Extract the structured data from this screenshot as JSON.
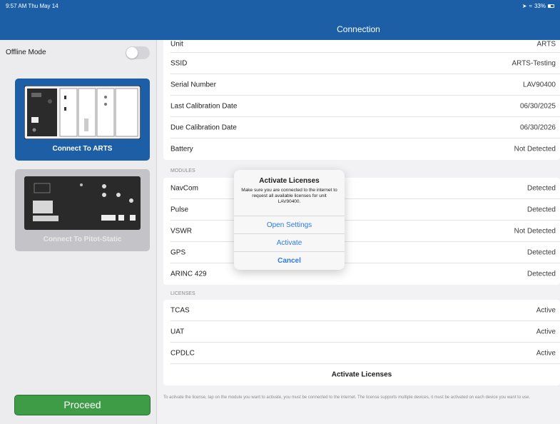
{
  "status": {
    "time": "9:57 AM  Thu May 14",
    "battery": "33%"
  },
  "nav": {
    "title": "Connection"
  },
  "sidebar": {
    "offline_label": "Offline Mode",
    "offline_on": false,
    "arts_label": "Connect To ARTS",
    "pitot_label": "Connect To Pitot-Static",
    "proceed_label": "Proceed"
  },
  "info_rows": [
    {
      "label": "Unit",
      "value": "ARTS"
    },
    {
      "label": "SSID",
      "value": "ARTS-Testing"
    },
    {
      "label": "Serial Number",
      "value": "LAV90400"
    },
    {
      "label": "Last Calibration Date",
      "value": "06/30/2025"
    },
    {
      "label": "Due Calibration Date",
      "value": "06/30/2026"
    },
    {
      "label": "Battery",
      "value": "Not Detected"
    }
  ],
  "modules_header": "MODULES",
  "modules": [
    {
      "label": "NavCom",
      "value": "Detected"
    },
    {
      "label": "Pulse",
      "value": "Detected"
    },
    {
      "label": "VSWR",
      "value": "Not Detected"
    },
    {
      "label": "GPS",
      "value": "Detected"
    },
    {
      "label": "ARINC 429",
      "value": "Detected"
    }
  ],
  "licenses_header": "LICENSES",
  "licenses": [
    {
      "label": "TCAS",
      "value": "Active"
    },
    {
      "label": "UAT",
      "value": "Active"
    },
    {
      "label": "CPDLC",
      "value": "Active"
    }
  ],
  "activate_licenses_label": "Activate Licenses",
  "footer_note": "To activate the license, tap on the module you want to activate, you must be connected to the internet. The license supports multiple devices, it must be activated on each device you want to use.",
  "dialog": {
    "title": "Activate Licenses",
    "message": "Make sure you are connected to the internet to request all available licenses for unit LAV90400.",
    "open_settings": "Open Settings",
    "activate": "Activate",
    "cancel": "Cancel"
  },
  "colors": {
    "accent": "#1c5fa6",
    "proceed": "#3e9c47",
    "link": "#2c7be0"
  }
}
